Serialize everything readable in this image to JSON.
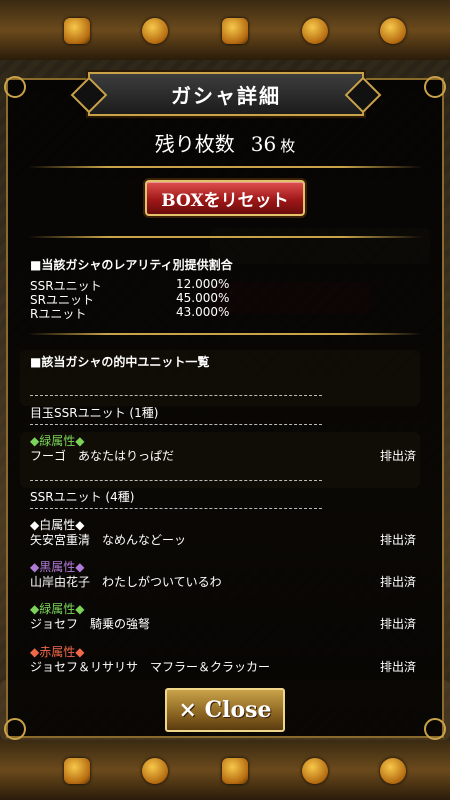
{
  "dialog": {
    "title": "ガシャ詳細",
    "remaining_label": "残り枚数",
    "remaining_count": "36",
    "remaining_unit": "枚",
    "reset_label": "BOXをリセット",
    "close_label": "× Close"
  },
  "rates": {
    "heading": "■当該ガシャのレアリティ別提供割合",
    "rows": [
      {
        "label": "SSRユニット",
        "value": "12.000%"
      },
      {
        "label": "SRユニット",
        "value": "45.000%"
      },
      {
        "label": "Rユニット",
        "value": "43.000%"
      }
    ]
  },
  "units": {
    "heading": "■該当ガシャの的中ユニット一覧",
    "featured_group": "目玉SSRユニット (1種)",
    "featured": [
      {
        "attribute": "◆緑属性◆",
        "name": "フーゴ　あなたはりっぱだ",
        "status": "排出済"
      }
    ],
    "ssr_group": "SSRユニット (4種)",
    "ssr": [
      {
        "attribute": "◆白属性◆",
        "name": "矢安宮重清　なめんなどーッ",
        "status": "排出済"
      },
      {
        "attribute": "◆黒属性◆",
        "name": "山岸由花子　わたしがついているわ",
        "status": "排出済"
      },
      {
        "attribute": "◆緑属性◆",
        "name": "ジョセフ　騎乗の強弩",
        "status": "排出済"
      },
      {
        "attribute": "◆赤属性◆",
        "name": "ジョセフ＆リサリサ　マフラー＆クラッカー",
        "status": "排出済"
      }
    ]
  },
  "colors": {
    "green": "#7cd35a",
    "white": "#ffffff",
    "black": "#b07ad8",
    "red": "#f06848",
    "gold": "#c9a24a"
  }
}
